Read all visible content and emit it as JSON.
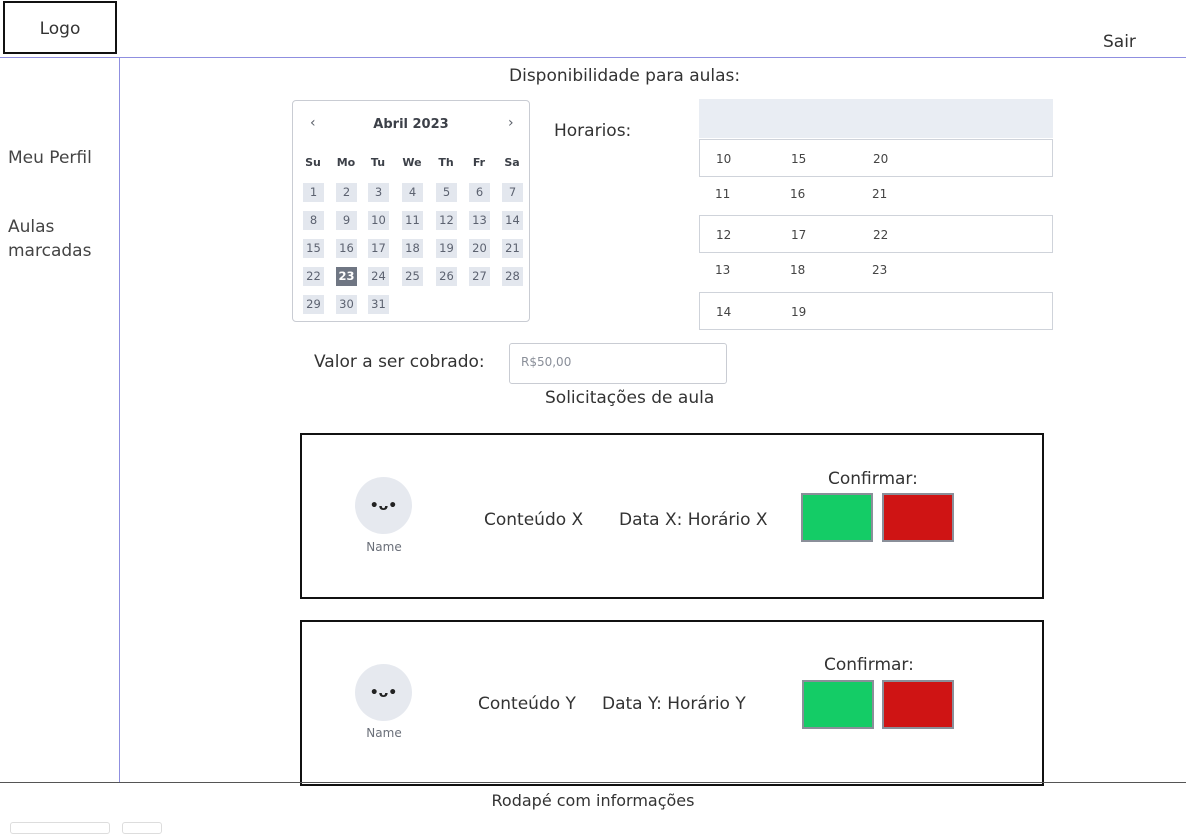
{
  "header": {
    "logo": "Logo",
    "logout": "Sair"
  },
  "sidebar": {
    "items": [
      {
        "label": "Meu Perfil"
      },
      {
        "label": "Aulas marcadas"
      }
    ]
  },
  "availability": {
    "title": "Disponibilidade para aulas:",
    "calendar": {
      "month": "Abril 2023",
      "prev": "‹",
      "next": "›",
      "weekdays": [
        "Su",
        "Mo",
        "Tu",
        "We",
        "Th",
        "Fr",
        "Sa"
      ],
      "selected_day": "23",
      "weeks": [
        [
          "1",
          "2",
          "3",
          "4",
          "5",
          "6",
          "7"
        ],
        [
          "8",
          "9",
          "10",
          "11",
          "12",
          "13",
          "14"
        ],
        [
          "15",
          "16",
          "17",
          "18",
          "19",
          "20",
          "21"
        ],
        [
          "22",
          "23",
          "24",
          "25",
          "26",
          "27",
          "28"
        ],
        [
          "29",
          "30",
          "31"
        ]
      ]
    },
    "times_label": "Horarios:",
    "times": [
      [
        "10",
        "15",
        "20"
      ],
      [
        "11",
        "16",
        "21"
      ],
      [
        "12",
        "17",
        "22"
      ],
      [
        "13",
        "18",
        "23"
      ],
      [
        "14",
        "19"
      ]
    ]
  },
  "price": {
    "label": "Valor a ser cobrado:",
    "placeholder": "R$50,00"
  },
  "requests": {
    "title": "Solicitações de aula",
    "items": [
      {
        "avatar_face": "•ᴗ•",
        "name": "Name",
        "content": "Conteúdo X",
        "datetime": "Data X: Horário X",
        "confirm_label": "Confirmar:"
      },
      {
        "avatar_face": "•ᴗ•",
        "name": "Name",
        "content": "Conteúdo Y",
        "datetime": "Data Y: Horário Y",
        "confirm_label": "Confirmar:"
      }
    ]
  },
  "footer": {
    "text": "Rodapé com informações"
  },
  "colors": {
    "accept": "#14cc66",
    "reject": "#cf1414",
    "divider": "#8f8fe0",
    "selected_day": "#6f7683"
  }
}
